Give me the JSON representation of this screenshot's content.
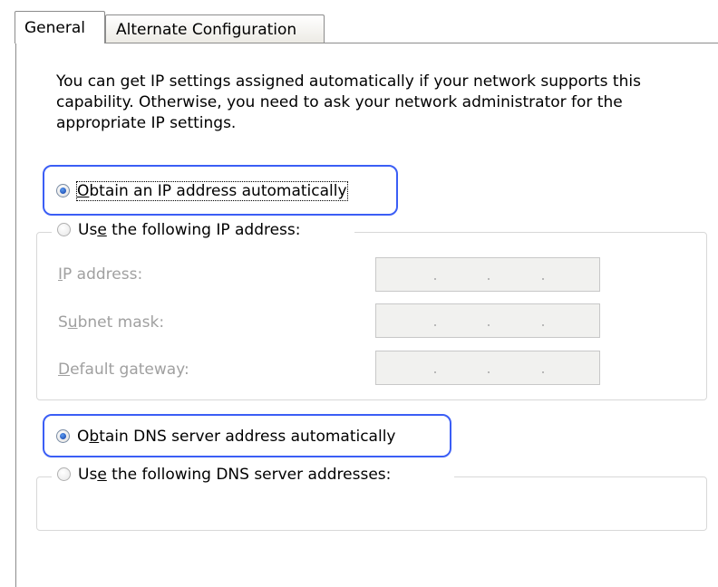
{
  "tabs": [
    {
      "label": "General",
      "selected": true
    },
    {
      "label": "Alternate Configuration",
      "selected": false
    }
  ],
  "intro_text": "You can get IP settings assigned automatically if your network supports this capability. Otherwise, you need to ask your network administrator for the appropriate IP settings.",
  "ip_section": {
    "auto_option": {
      "pre": "",
      "mnemonic": "O",
      "post": "btain an IP address automatically",
      "checked": true
    },
    "manual_option": {
      "pre": "Us",
      "mnemonic": "e",
      "post": " the following IP address:",
      "checked": false
    },
    "fields": [
      {
        "pre": "",
        "mnemonic": "I",
        "post": "P address:"
      },
      {
        "pre": "S",
        "mnemonic": "u",
        "post": "bnet mask:"
      },
      {
        "pre": "",
        "mnemonic": "D",
        "post": "efault gateway:"
      }
    ]
  },
  "dns_section": {
    "auto_option": {
      "pre": "O",
      "mnemonic": "b",
      "post": "tain DNS server address automatically",
      "checked": true
    },
    "manual_option": {
      "pre": "Us",
      "mnemonic": "e",
      "post": " the following DNS server addresses:",
      "checked": false
    }
  },
  "colors": {
    "highlight": "#3b5ef5",
    "radio_dot": "#1f4fb4"
  }
}
